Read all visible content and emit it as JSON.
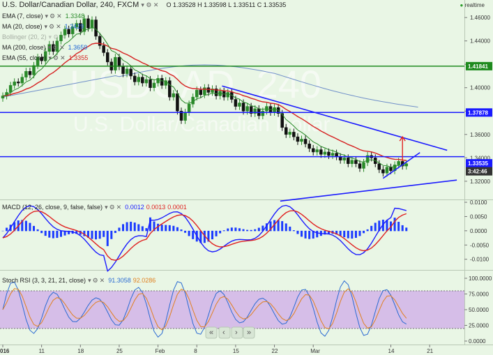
{
  "header": {
    "symbol_title": "U.S. Dollar/Canadian Dollar, 240, FXCM",
    "ohlc": {
      "O": "1.33528",
      "H": "1.33598",
      "L": "1.33511",
      "C": "1.33535"
    },
    "realtime": "realtime"
  },
  "watermark": {
    "big": "USDCAD, 240",
    "small": "U.S. Dollar/Canadian Dollar"
  },
  "price_legend": [
    {
      "label": "EMA (7, close)",
      "value": "1.3348",
      "color": "#2a8a2a"
    },
    {
      "label": "MA (20, close)",
      "value": "1.3429",
      "color": "#1e64d2"
    },
    {
      "label": "Bollinger (20, 2)",
      "value": "",
      "color": "#1e64d2",
      "faded": true
    },
    {
      "label": "MA (200, close)",
      "value": "1.3659",
      "color": "#1e64d2"
    },
    {
      "label": "EMA (55, close)",
      "value": "1.3355",
      "color": "#d62020"
    }
  ],
  "macd_legend": {
    "label": "MACD (12, 26, close, 9, false, false)",
    "values": [
      "0.0012",
      "0.0013",
      "0.0001"
    ]
  },
  "stoch_legend": {
    "label": "Stoch RSI (3, 3, 21, 21, close)",
    "values": [
      "91.3058",
      "92.0286"
    ]
  },
  "price_axis_ticks": [
    "1.46000",
    "1.44000",
    "1.42000",
    "1.40000",
    "1.38000",
    "1.36000",
    "1.34000",
    "1.32000"
  ],
  "price_axis_labels": [
    {
      "text": "1.41841",
      "value": 1.41841,
      "color": "#1e8a1e"
    },
    {
      "text": "1.37878",
      "value": 1.37878,
      "color": "#1a1aff"
    },
    {
      "text": "1.33535",
      "value": 1.33535,
      "color": "#1a1aff"
    },
    {
      "text": "3:42:46",
      "value": 1.3285,
      "color": "#333333"
    }
  ],
  "macd_axis_ticks": [
    "0.0100",
    "0.0050",
    "0.0000",
    "-0.0050",
    "-0.0100"
  ],
  "stoch_axis_ticks": [
    "100.0000",
    "75.0000",
    "50.0000",
    "25.0000",
    "0.0000"
  ],
  "time_labels": [
    "016",
    "11",
    "18",
    "25",
    "Feb",
    "8",
    "15",
    "22",
    "Mar",
    "14",
    "21"
  ],
  "colors": {
    "background": "#e9f6e5",
    "green_line": "#1e8a1e",
    "blue_line": "#1a1aff",
    "stoch_fill": "#d4b8e8",
    "up": "#2a8a2a",
    "down": "#111111"
  },
  "chart_data": [
    {
      "type": "candlestick",
      "title": "U.S. Dollar/Canadian Dollar, 240, FXCM",
      "ylim": [
        1.305,
        1.475
      ],
      "x_range": [
        0,
        110
      ],
      "x_tick_positions": {
        "016": 0,
        "11": 10,
        "18": 20,
        "25": 30,
        "Feb": 40,
        "8": 50,
        "15": 60,
        "22": 70,
        "Mar": 80,
        "14": 100,
        "21": 110
      },
      "horizontal_levels": [
        {
          "value": 1.41841,
          "color": "#1e8a1e"
        },
        {
          "value": 1.37878,
          "color": "#1a1aff"
        },
        {
          "value": 1.341,
          "color": "#1a1aff"
        }
      ],
      "trendlines": [
        {
          "from": [
            56.5,
            1.4015
          ],
          "to": [
            114.5,
            1.3465
          ]
        },
        {
          "from": [
            71.5,
            1.303
          ],
          "to": [
            117,
            1.321
          ]
        },
        {
          "from": [
            98,
            1.3225
          ],
          "to": [
            107.5,
            1.3445
          ]
        }
      ],
      "arrow": {
        "from": [
          103,
          1.3375
        ],
        "to": [
          103,
          1.358
        ]
      },
      "close": [
        1.393,
        1.396,
        1.402,
        1.405,
        1.404,
        1.409,
        1.414,
        1.411,
        1.419,
        1.426,
        1.423,
        1.431,
        1.437,
        1.431,
        1.44,
        1.445,
        1.45,
        1.446,
        1.452,
        1.455,
        1.448,
        1.459,
        1.451,
        1.458,
        1.444,
        1.436,
        1.43,
        1.422,
        1.415,
        1.426,
        1.418,
        1.412,
        1.416,
        1.41,
        1.405,
        1.409,
        1.404,
        1.407,
        1.4,
        1.404,
        1.408,
        1.402,
        1.406,
        1.392,
        1.395,
        1.38,
        1.372,
        1.379,
        1.386,
        1.392,
        1.398,
        1.394,
        1.4,
        1.396,
        1.399,
        1.393,
        1.397,
        1.392,
        1.396,
        1.39,
        1.384,
        1.387,
        1.38,
        1.384,
        1.378,
        1.382,
        1.376,
        1.38,
        1.384,
        1.379,
        1.383,
        1.378,
        1.366,
        1.36,
        1.362,
        1.358,
        1.354,
        1.356,
        1.352,
        1.348,
        1.345,
        1.347,
        1.343,
        1.345,
        1.342,
        1.344,
        1.341,
        1.338,
        1.34,
        1.335,
        1.338,
        1.335,
        1.331,
        1.336,
        1.342,
        1.34,
        1.335,
        1.33,
        1.327,
        1.332,
        1.329,
        1.334,
        1.337,
        1.333,
        1.335
      ],
      "ema7_last": 1.3348,
      "ema55_last": 1.3355,
      "ma200_last": 1.3659
    },
    {
      "type": "macd",
      "title": "MACD (12, 26, close, 9, false, false)",
      "ylim": [
        -0.0135,
        0.0105
      ],
      "macd_last": 0.0012,
      "signal_last": 0.0013,
      "hist_last": 0.0001
    },
    {
      "type": "stoch_rsi",
      "title": "Stoch RSI (3, 3, 21, 21, close)",
      "ylim": [
        0,
        100
      ],
      "bands": [
        20,
        80
      ],
      "k_last": 91.3058,
      "d_last": 92.0286
    }
  ]
}
